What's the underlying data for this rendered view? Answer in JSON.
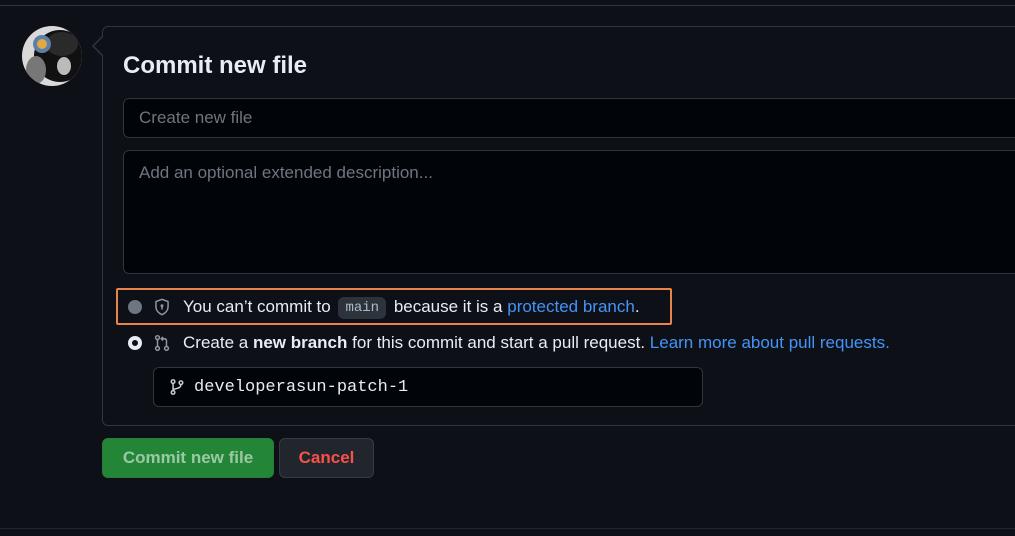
{
  "commit": {
    "title": "Commit new file",
    "summary_placeholder": "Create new file",
    "description_placeholder": "Add an optional extended description..."
  },
  "options": {
    "protected": {
      "text_before": "You can’t commit to",
      "branch": "main",
      "text_middle": "because it is a",
      "link": "protected branch",
      "text_after": "."
    },
    "new_branch": {
      "text_before": "Create a",
      "bold": "new branch",
      "text_middle": "for this commit and start a pull request.",
      "link": "Learn more about pull requests."
    }
  },
  "branch_name": "developerasun-patch-1",
  "buttons": {
    "commit": "Commit new file",
    "cancel": "Cancel"
  },
  "icons": {
    "protected": "shield-lock-icon",
    "pull_request": "git-pull-request-icon",
    "branch": "git-branch-icon"
  },
  "colors": {
    "accent_link": "#4493f8",
    "highlight": "#e8834a",
    "commit_button": "#238636",
    "cancel_text": "#f85149"
  }
}
